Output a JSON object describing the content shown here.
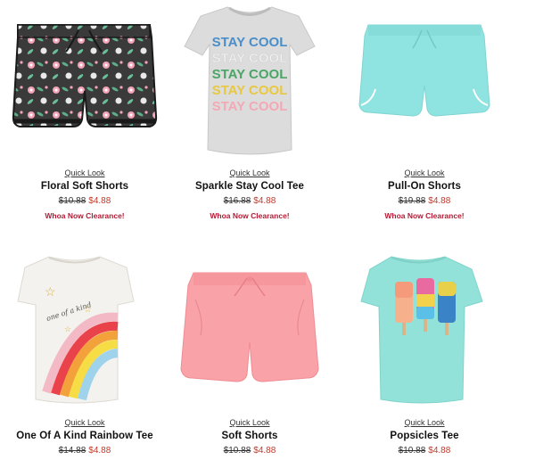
{
  "products": [
    {
      "name": "Floral Soft Shorts",
      "quick_look": "Quick Look",
      "old_price": "$10.88",
      "new_price": "$4.88",
      "promo": "Whoa Now Clearance!"
    },
    {
      "name": "Sparkle Stay Cool Tee",
      "quick_look": "Quick Look",
      "old_price": "$16.88",
      "new_price": "$4.88",
      "promo": "Whoa Now Clearance!",
      "shirt_text": [
        "STAY COOL",
        "STAY COOL",
        "STAY COOL",
        "STAY COOL",
        "STAY COOL"
      ]
    },
    {
      "name": "Pull-On Shorts",
      "quick_look": "Quick Look",
      "old_price": "$19.88",
      "new_price": "$4.88",
      "promo": "Whoa Now Clearance!"
    },
    {
      "name": "One Of A Kind Rainbow Tee",
      "quick_look": "Quick Look",
      "old_price": "$14.88",
      "new_price": "$4.88",
      "shirt_text": "one of a kind"
    },
    {
      "name": "Soft Shorts",
      "quick_look": "Quick Look",
      "old_price": "$10.88",
      "new_price": "$4.88"
    },
    {
      "name": "Popsicles Tee",
      "quick_look": "Quick Look",
      "old_price": "$10.88",
      "new_price": "$4.88"
    }
  ],
  "colors": {
    "sale_price": "#c0392b",
    "promo": "#b31b34"
  }
}
